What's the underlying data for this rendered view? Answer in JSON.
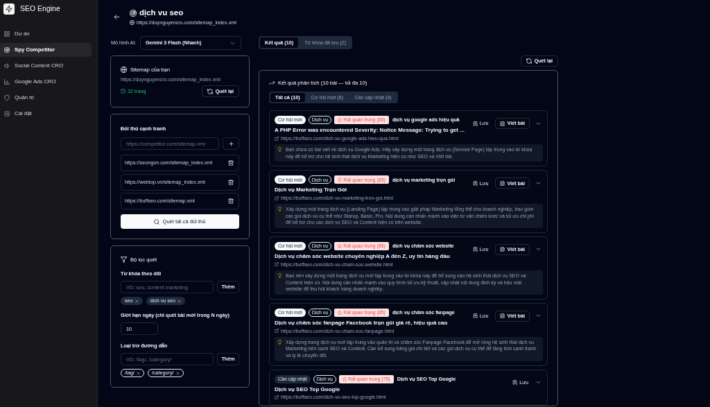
{
  "sidebar": {
    "brand": "SEO Engine",
    "items": [
      {
        "label": "Dự án",
        "selected": false
      },
      {
        "label": "Spy Competitor",
        "selected": true
      },
      {
        "label": "Social Content CRO",
        "selected": false
      },
      {
        "label": "Google Ads CRO",
        "selected": false
      },
      {
        "label": "Quản trị",
        "selected": false
      },
      {
        "label": "Cài đặt",
        "selected": false
      }
    ]
  },
  "header": {
    "title": "dịch vu seo",
    "url": "https://duynguyencro.com/sitemap_index.xml"
  },
  "model": {
    "label": "Mô hình AI:",
    "value": "Gemini 3 Flash (Nhanh)"
  },
  "sitemap": {
    "title": "Sitemap của bạn",
    "url": "https://duynguyencro.com/sitemap_index.xml",
    "pages": "32 trang",
    "rescan_button": "Quét lại"
  },
  "competitors": {
    "title": "Đối thủ cạnh tranh",
    "input": {
      "placeholder": "https://competitor.com/sitemap.xml"
    },
    "items": [
      "https://seongon.com/sitemap_index.xml",
      "https://webtop.vn/sitemap_index.xml",
      "https://buffseo.com/sitemap.xml"
    ],
    "scan_button": "Quét tất cả đối thủ"
  },
  "filters": {
    "title": "Bộ lọc quét",
    "keywords": {
      "label": "Từ khóa theo dõi",
      "placeholder": "VD: seo, content marketing",
      "button": "Thêm",
      "tags": [
        "seo",
        "dịch vụ seo"
      ]
    },
    "days": {
      "label": "Giới hạn ngày (chỉ quét bài mới trong N ngày)",
      "value": "10"
    },
    "exclude": {
      "label": "Loại trừ đường dẫn",
      "placeholder": "VD: /tag/, /category/",
      "button": "Thêm",
      "tags": [
        "/tag/",
        "/category/"
      ]
    }
  },
  "view_tabs": [
    {
      "label": "Kết quả (10)",
      "selected": true
    },
    {
      "label": "Từ khóa đã lưu (2)",
      "selected": false
    }
  ],
  "rescan_button": "Quét lại",
  "results": {
    "title": "Kết quả phân tích (10 bài — tối đa 10)",
    "filter_tabs": [
      {
        "label": "Tất cả (10)",
        "selected": true
      },
      {
        "label": "Cơ hội mới (6)",
        "selected": false
      },
      {
        "label": "Cần cập nhật (4)",
        "selected": false
      }
    ],
    "items": [
      {
        "status": {
          "label": "Cơ hội mới",
          "kind": "new"
        },
        "type": "Dịch vụ",
        "priority": "Rất quan trọng (85)",
        "keyword": "dịch vụ google ads hiệu quả",
        "save": "Lưu",
        "write": "Viết bài",
        "title": "A PHP Error was encountered Severity: Notice Message: Trying to get ...",
        "url": "https://buffseo.com/dich-vu-google-ads-hieu-qua.html",
        "insight": "Bạn chưa có bài viết về dịch vụ Google Ads. Hãy xây dựng một trang dịch vụ (Service Page) tập trung vào từ khóa này để bổ trợ cho hệ sinh thái dịch vụ Marketing hiện có như SEO và Viết bài."
      },
      {
        "status": {
          "label": "Cơ hội mới",
          "kind": "new"
        },
        "type": "Dịch vụ",
        "priority": "Rất quan trọng (85)",
        "keyword": "dịch vụ marketing trọn gói",
        "save": "Lưu",
        "write": "Viết bài",
        "title": "Dịch vụ Marketing Trọn Gói",
        "url": "https://buffseo.com/dich-vu-marketing-tron-goi.html",
        "insight": "Xây dựng một trang dịch vụ (Landing Page) tập trung vào giải pháp Marketing tổng thể cho doanh nghiệp, bao gồm các gói dịch vụ cụ thể như Starup, Basic, Pro. Nội dung cần nhấn mạnh vào việc tư vấn chiến lược và tối ưu chi phí để bổ trợ cho các dịch vụ SEO và Content hiện có trên website."
      },
      {
        "status": {
          "label": "Cơ hội mới",
          "kind": "new"
        },
        "type": "Dịch vụ",
        "priority": "Rất quan trọng (85)",
        "keyword": "dịch vụ chăm sóc website",
        "save": "Lưu",
        "write": "Viết bài",
        "title": "Dịch vụ chăm sóc website chuyên nghiệp A đến Z, uy tín hàng đầu",
        "url": "https://buffseo.com/dich-vu-cham-soc-website.html",
        "insight": "Bạn nên xây dựng một trang dịch vụ mới tập trung vào từ khóa này để bổ sung vào hệ sinh thái dịch vụ SEO và Content hiện có. Nội dung cần nhấn mạnh vào quy trình tối ưu kỹ thuật, cập nhật nội dung định kỳ và bảo mật website để thu hút khách hàng doanh nghiệp."
      },
      {
        "status": {
          "label": "Cơ hội mới",
          "kind": "new"
        },
        "type": "Dịch vụ",
        "priority": "Rất quan trọng (85)",
        "keyword": "dịch vụ chăm sóc fanpage",
        "save": "Lưu",
        "write": "Viết bài",
        "title": "Dịch vụ chăm sóc fanpage Facebook trọn gói giá rẻ, hiệu quả cao",
        "url": "https://buffseo.com/dich-vu-cham-soc-fanpage.html",
        "insight": "Xây dựng trang dịch vụ mới tập trung vào quản trị và chăm sóc Fanpage Facebook để mở rộng hệ sinh thái dịch vụ Marketing bên cạnh SEO và Content. Cần bổ sung bảng giá chi tiết và các gói dịch vụ cụ thể để tăng tính cạnh tranh và tỷ lệ chuyển đổi."
      },
      {
        "status": {
          "label": "Cần cập nhật",
          "kind": "update"
        },
        "type": "Dịch vụ",
        "priority": "Rất quan trọng (75)",
        "keyword": "Dịch vụ SEO Top Google",
        "save": "Lưu",
        "title": "Dịch vụ SEO Top Google",
        "url": "https://buffseo.com/dich-vu-seo-top-google.html"
      }
    ]
  }
}
